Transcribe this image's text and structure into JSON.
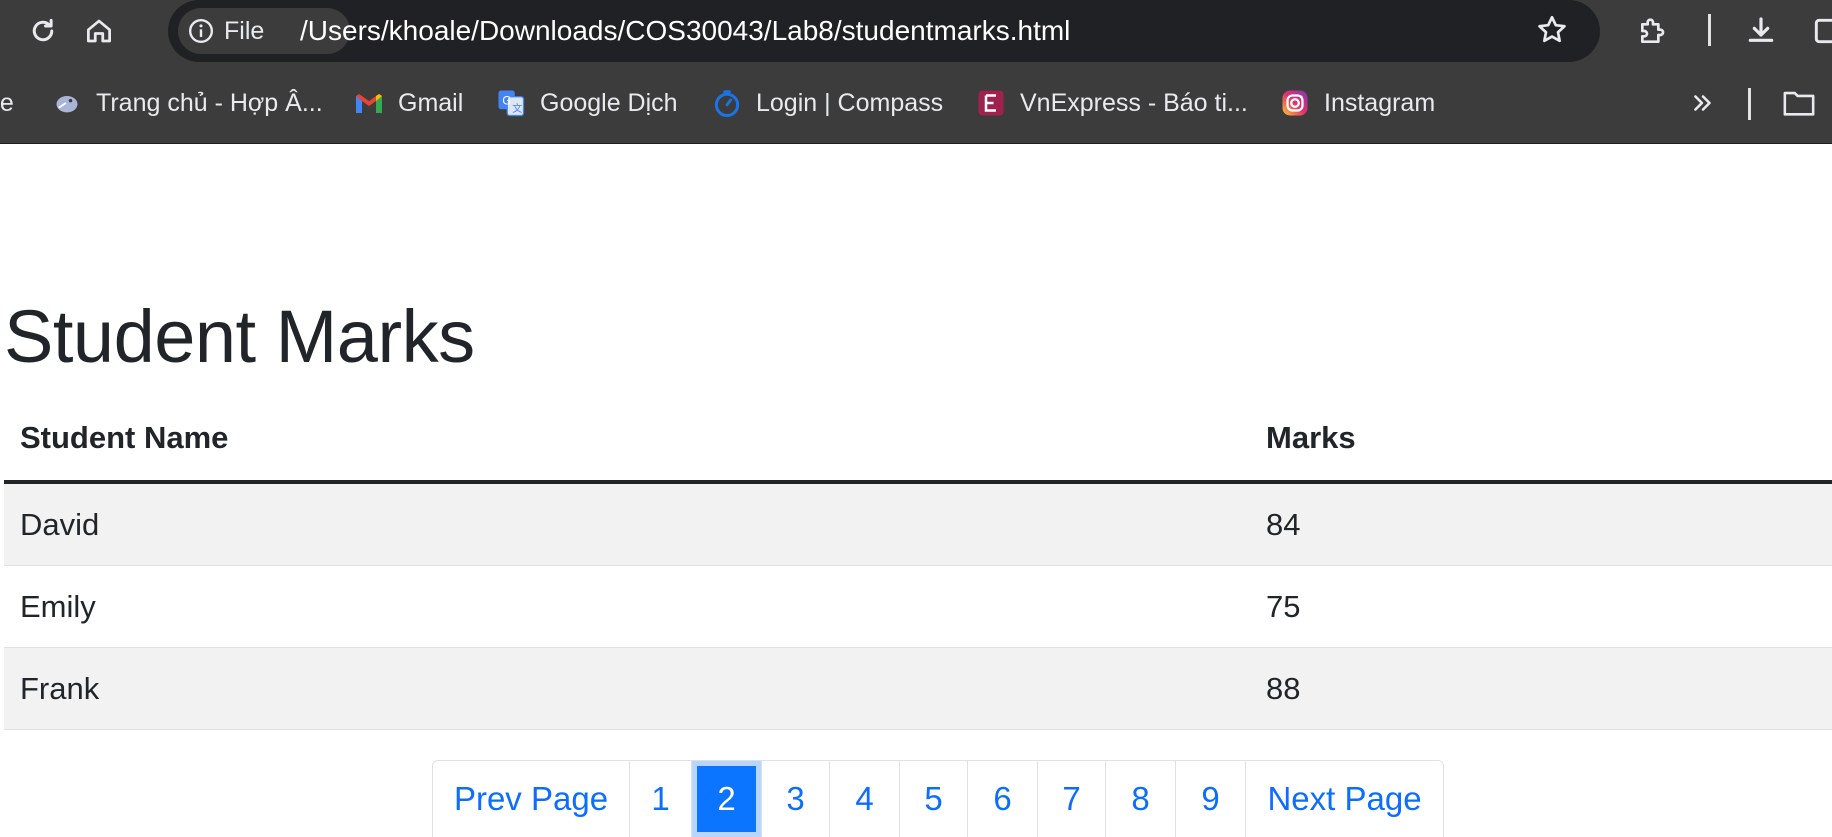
{
  "browser": {
    "url_chip_label": "File",
    "url": "/Users/khoale/Downloads/COS30043/Lab8/studentmarks.html",
    "bookmarks": [
      {
        "label": "be",
        "icon": "bookmark-icon"
      },
      {
        "label": "Trang chủ - Hợp Â...",
        "icon": "bird-icon"
      },
      {
        "label": "Gmail",
        "icon": "gmail-icon"
      },
      {
        "label": "Google Dịch",
        "icon": "google-translate-icon"
      },
      {
        "label": "Login | Compass",
        "icon": "compass-icon"
      },
      {
        "label": "VnExpress - Báo ti...",
        "icon": "vnexpress-icon"
      },
      {
        "label": "Instagram",
        "icon": "instagram-icon"
      }
    ]
  },
  "page": {
    "title": "Student Marks",
    "table": {
      "headers": [
        "Student Name",
        "Marks"
      ],
      "rows": [
        [
          "David",
          "84"
        ],
        [
          "Emily",
          "75"
        ],
        [
          "Frank",
          "88"
        ]
      ]
    },
    "pagination": {
      "prev_label": "Prev Page",
      "pages": [
        "1",
        "2",
        "3",
        "4",
        "5",
        "6",
        "7",
        "8",
        "9"
      ],
      "active_page": "2",
      "next_label": "Next Page"
    }
  },
  "colors": {
    "accent": "#0d6efd",
    "active_page_bg": "#0b75ff",
    "browser_toolbar": "#3c3c3c",
    "omnibox": "#202124"
  }
}
